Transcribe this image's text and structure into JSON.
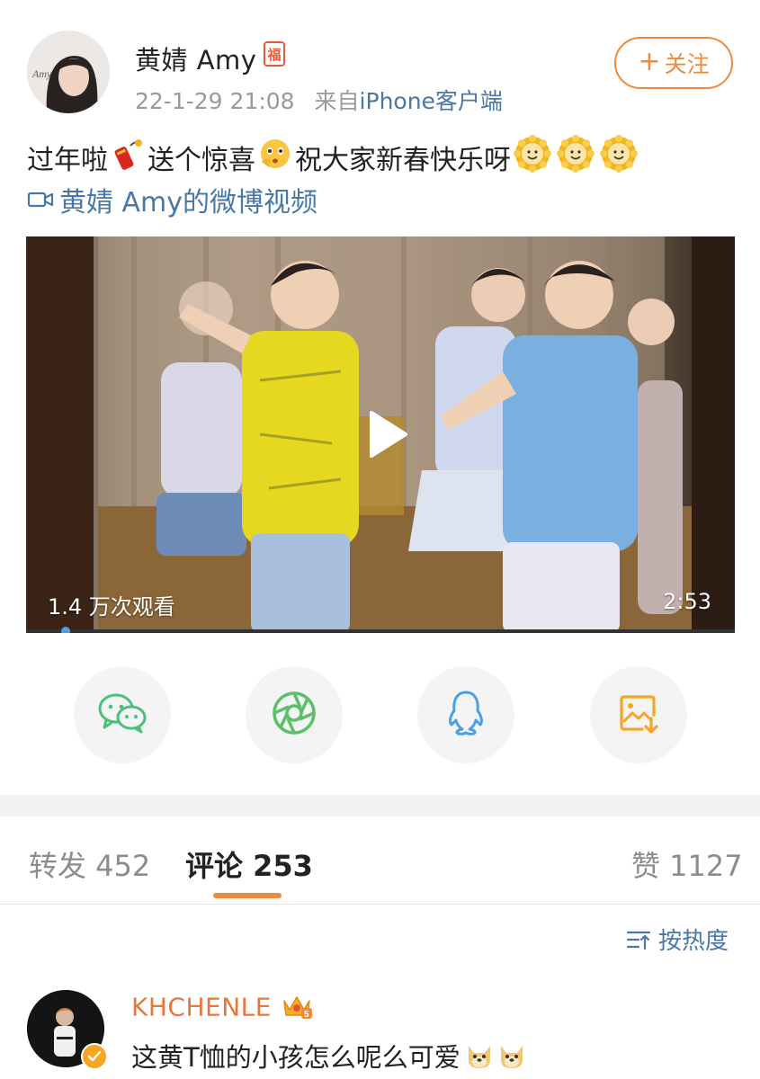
{
  "header": {
    "username": "黄婧 Amy",
    "badge": "福",
    "date": "22-1-29 21:08",
    "source_prefix": "来自",
    "source": "iPhone客户端",
    "follow_label": "关注"
  },
  "post": {
    "text_part1": "过年啦",
    "text_part2": "送个惊喜",
    "text_part3": "祝大家新春快乐呀",
    "emoji_icons": [
      "firecracker-icon",
      "surprised-face-icon",
      "sun-face-icon",
      "sun-face-icon",
      "sun-face-icon"
    ],
    "video_link": "黄婧 Amy的微博视频"
  },
  "video": {
    "views": "1.4 万次观看",
    "duration": "2:53",
    "progress": 0.05
  },
  "share": [
    {
      "name": "wechat",
      "icon": "wechat-icon",
      "color": "#4cbf7a"
    },
    {
      "name": "moments",
      "icon": "moments-icon",
      "color": "#5cc06a"
    },
    {
      "name": "qq",
      "icon": "qq-icon",
      "color": "#4aa0e8"
    },
    {
      "name": "save-image",
      "icon": "save-image-icon",
      "color": "#f5a623"
    }
  ],
  "tabs": {
    "repost": "转发 452",
    "comments": "评论 253",
    "likes": "赞 1127"
  },
  "sort_label": "按热度",
  "comment": {
    "name": "KHCHENLE",
    "text": "这黄T恤的小孩怎么呢么可爱"
  },
  "colors": {
    "accent": "#f08a3a",
    "link": "#4a78a6"
  }
}
